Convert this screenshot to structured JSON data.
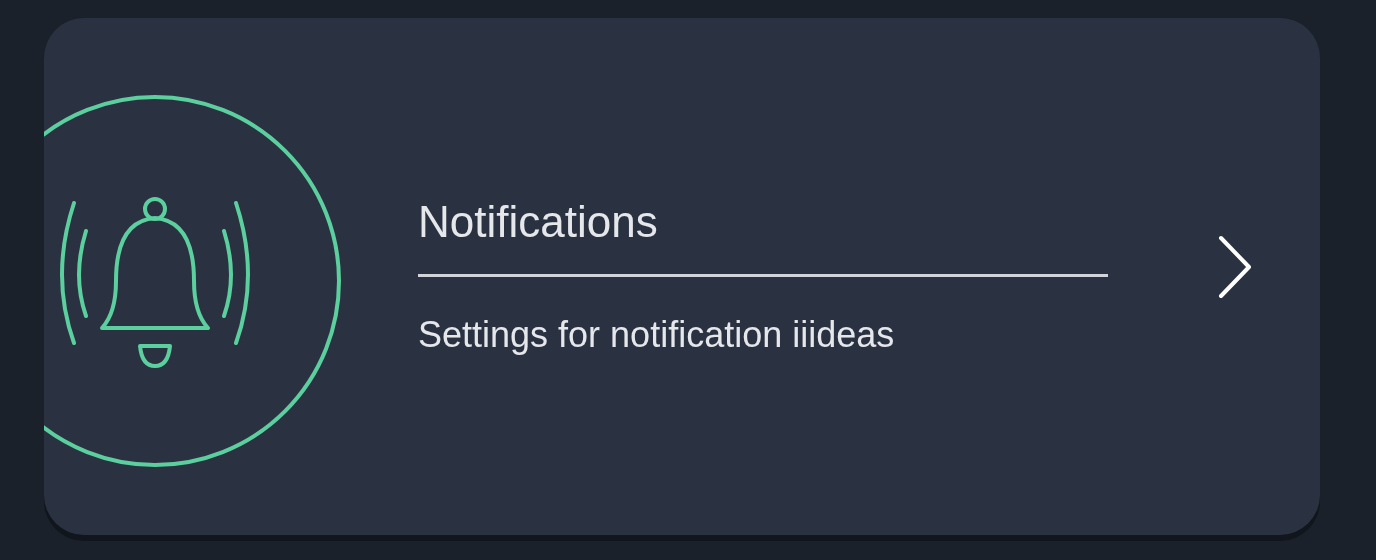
{
  "card": {
    "title": "Notifications",
    "subtitle": "Settings for notification iiideas"
  }
}
